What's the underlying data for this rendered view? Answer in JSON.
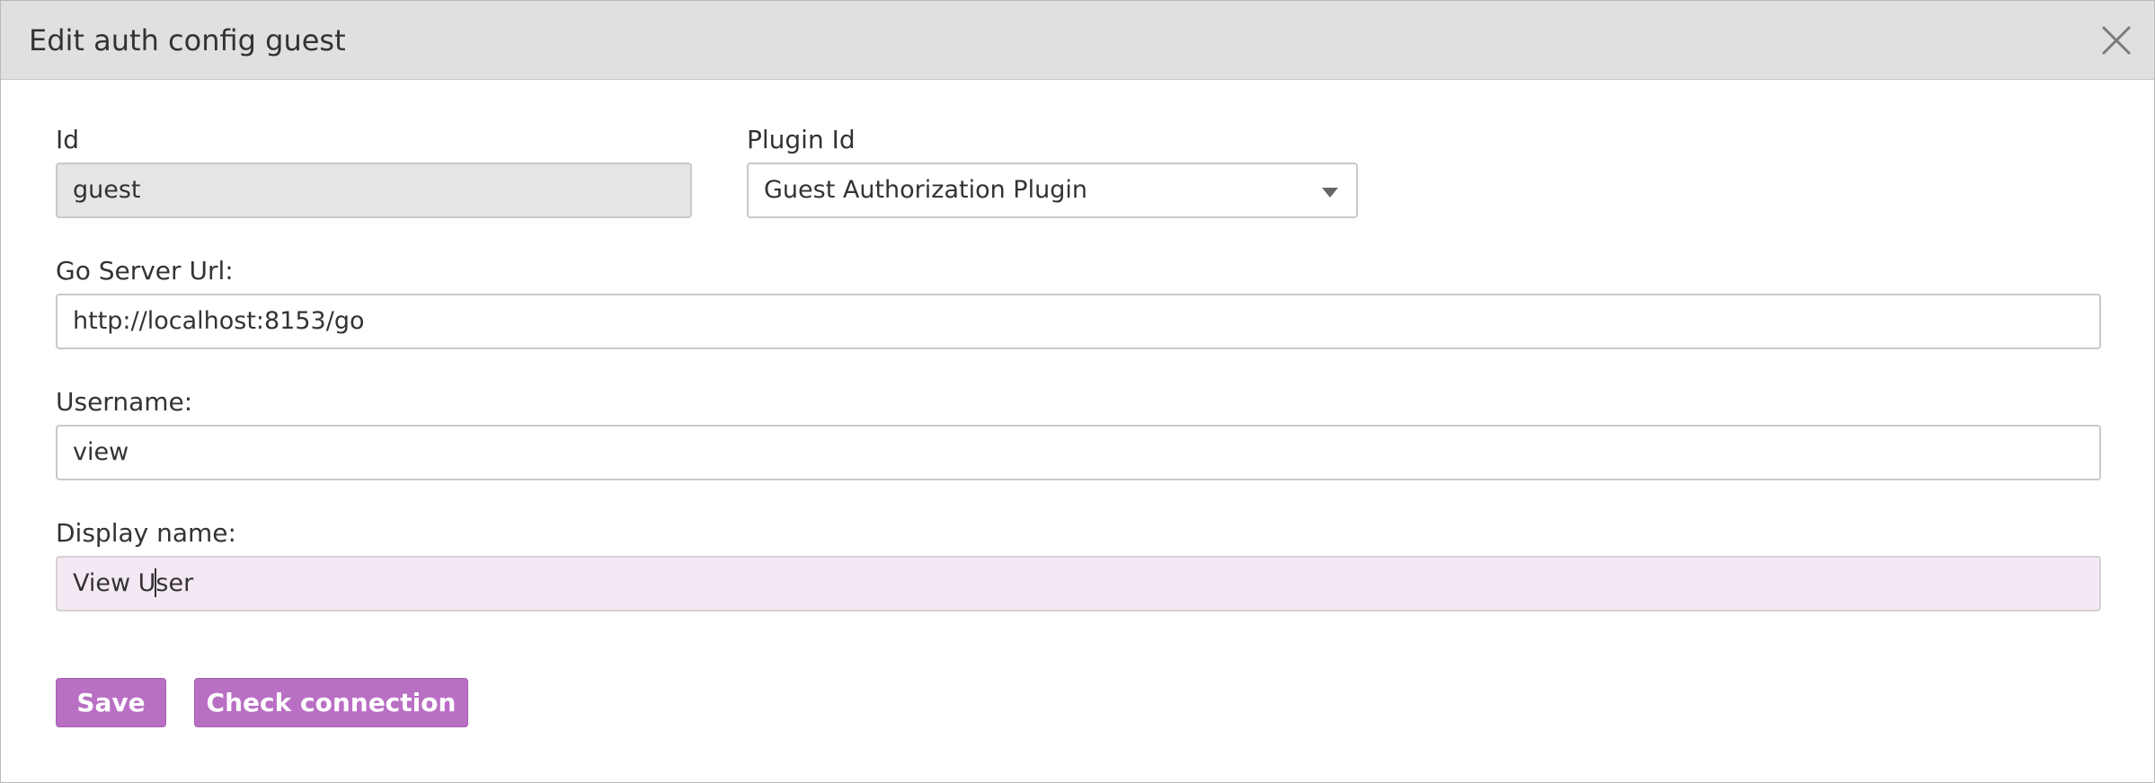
{
  "dialog": {
    "title": "Edit auth config guest",
    "close_icon": "close-icon"
  },
  "form": {
    "id": {
      "label": "Id",
      "value": "guest",
      "readonly": true
    },
    "plugin_id": {
      "label": "Plugin Id",
      "selected": "Guest Authorization Plugin"
    },
    "go_server_url": {
      "label": "Go Server Url:",
      "value": "http://localhost:8153/go"
    },
    "username": {
      "label": "Username:",
      "value": "view"
    },
    "display_name": {
      "label": "Display name:",
      "value_before_cursor": "View U",
      "value_after_cursor": "ser"
    }
  },
  "buttons": {
    "save_label": "Save",
    "check_connection_label": "Check connection"
  },
  "colors": {
    "header_bg": "#e0e0e0",
    "button_bg": "#b96fc4",
    "focused_field_bg": "#f4e8f4",
    "readonly_field_bg": "#e6e6e6"
  }
}
